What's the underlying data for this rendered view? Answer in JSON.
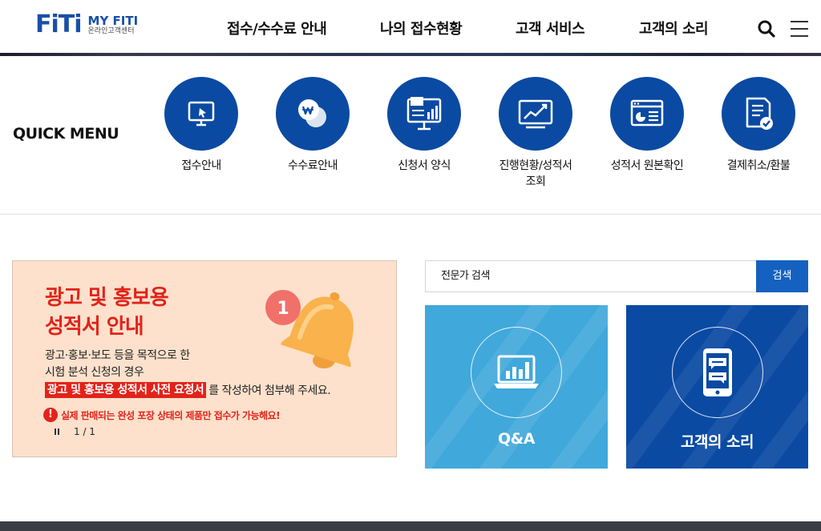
{
  "header": {
    "logo_main": "FiTi",
    "logo_title": "MY FITI",
    "logo_subtitle": "온라인고객센터",
    "nav": [
      "접수/수수료 안내",
      "나의 접수현황",
      "고객 서비스",
      "고객의 소리"
    ],
    "icons": {
      "search": "search-icon",
      "menu": "hamburger-menu-icon"
    }
  },
  "quick_menu": {
    "title": "QUICK MENU",
    "items": [
      {
        "label": "접수안내",
        "icon": "monitor-cursor-icon"
      },
      {
        "label": "수수료안내",
        "icon": "coin-won-icon"
      },
      {
        "label": "신청서 양식",
        "icon": "presentation-board-icon"
      },
      {
        "label": "진행현황/성적서\n조회",
        "icon": "chart-monitor-icon"
      },
      {
        "label": "성적서 원본확인",
        "icon": "document-window-icon"
      },
      {
        "label": "결제취소/환불",
        "icon": "document-check-icon"
      }
    ]
  },
  "banner": {
    "title_line1": "광고 및 홍보용",
    "title_line2": "성적서 안내",
    "body_line1": "광고·홍보·보도 등을 목적으로 한",
    "body_line2": "시험 분석 신청의 경우",
    "highlight": "광고 및 홍보용 성적서 사전 요청서",
    "highlight_suffix": "를 작성하여 첨부해 주세요.",
    "warning": "실제 판매되는 완성 포장 상태의 제품만 접수가 가능해요!",
    "warning_mark": "!",
    "bell_badge": "1",
    "pager": "1 / 1"
  },
  "search": {
    "input_value": "전문가 검색",
    "button_label": "검색"
  },
  "cards": [
    {
      "label": "Q&A",
      "icon": "laptop-chart-icon",
      "color": "#40a8db"
    },
    {
      "label": "고객의 소리",
      "icon": "mobile-chat-icon",
      "color": "#0a4aa3"
    }
  ],
  "colors": {
    "brand": "#0b4aa2",
    "accent": "#1561c0",
    "alert": "#e2231a",
    "banner_bg": "#fde1cc"
  }
}
